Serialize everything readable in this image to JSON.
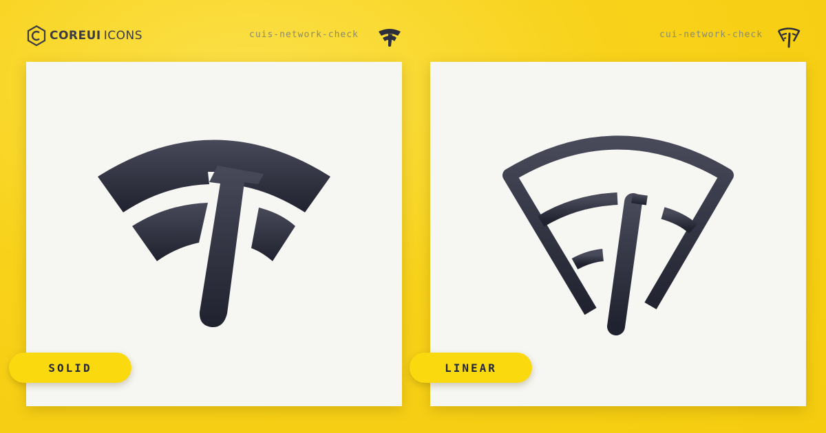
{
  "brand": {
    "name_bold": "COREUI",
    "name_thin": "ICONS",
    "logo_icon": "coreui-hexagon-icon"
  },
  "solid": {
    "icon_name": "cuis-network-check",
    "style_label": "SOLID",
    "icon": "network-check-solid-icon"
  },
  "linear": {
    "icon_name": "cui-network-check",
    "style_label": "LINEAR",
    "icon": "network-check-linear-icon"
  },
  "colors": {
    "background": "#f8d21a",
    "icon": "#2d2e3b",
    "panel": "#f6f6f2",
    "pill": "#fbd90f"
  }
}
